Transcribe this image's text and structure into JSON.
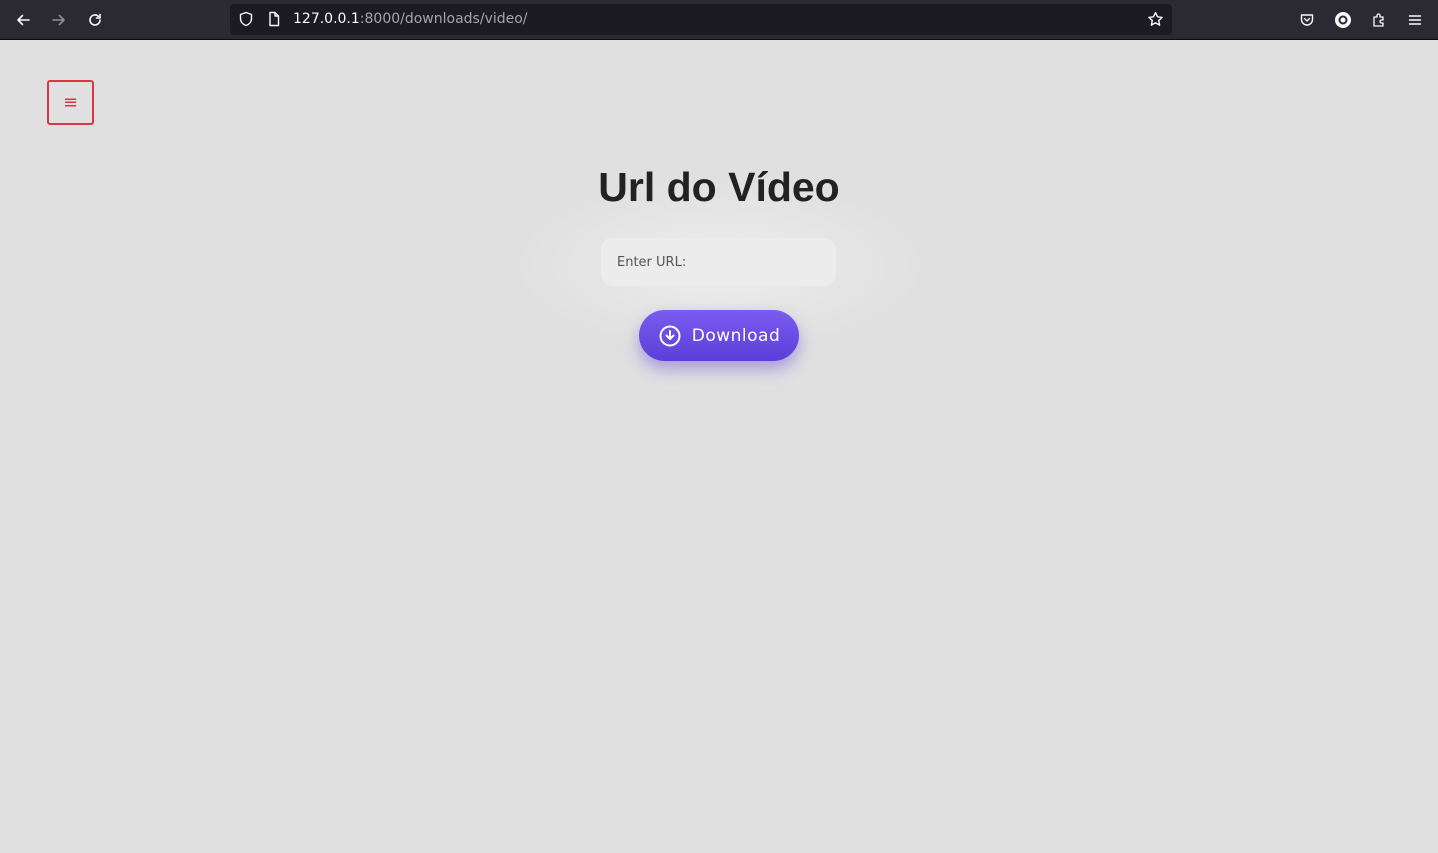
{
  "browser": {
    "url_host": "127.0.0.1",
    "url_path": ":8000/downloads/video/"
  },
  "page": {
    "menu_toggle_symbol": "≡",
    "title": "Url do Vídeo",
    "input": {
      "placeholder": "Enter URL:",
      "value": ""
    },
    "download_button_label": "Download",
    "download_icon": "cloud-download-icon"
  },
  "colors": {
    "browser_chrome": "#2b2a33",
    "url_field": "#1c1b22",
    "page_background": "#e0e0e0",
    "menu_toggle": "#dc3545",
    "button_gradient_start": "#7a5cf0",
    "button_gradient_end": "#5a3fd8",
    "title": "#222222"
  }
}
